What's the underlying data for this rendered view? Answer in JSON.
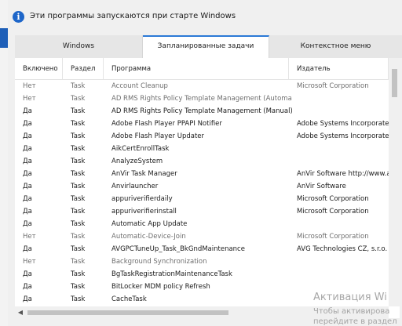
{
  "info": {
    "icon": "info-icon",
    "text": "Эти программы запускаются при старте Windows"
  },
  "tabs": [
    {
      "label": "Windows",
      "active": false
    },
    {
      "label": "Запланированные задачи",
      "active": true
    },
    {
      "label": "Контекстное меню",
      "active": false
    }
  ],
  "table": {
    "columns": [
      "Включено",
      "Раздел",
      "Программа",
      "Издатель"
    ],
    "rows": [
      {
        "enabled": "Нет",
        "section": "Task",
        "program": "Account Cleanup",
        "publisher": "Microsoft Corporation"
      },
      {
        "enabled": "Нет",
        "section": "Task",
        "program": "AD RMS Rights Policy Template Management (Automated)",
        "publisher": ""
      },
      {
        "enabled": "Да",
        "section": "Task",
        "program": "AD RMS Rights Policy Template Management (Manual)",
        "publisher": ""
      },
      {
        "enabled": "Да",
        "section": "Task",
        "program": "Adobe Flash Player PPAPI Notifier",
        "publisher": "Adobe Systems Incorporated"
      },
      {
        "enabled": "Да",
        "section": "Task",
        "program": "Adobe Flash Player Updater",
        "publisher": "Adobe Systems Incorporated"
      },
      {
        "enabled": "Да",
        "section": "Task",
        "program": "AikCertEnrollTask",
        "publisher": ""
      },
      {
        "enabled": "Да",
        "section": "Task",
        "program": "AnalyzeSystem",
        "publisher": ""
      },
      {
        "enabled": "Да",
        "section": "Task",
        "program": "AnVir Task Manager",
        "publisher": "AnVir Software http://www.an"
      },
      {
        "enabled": "Да",
        "section": "Task",
        "program": "Anvirlauncher",
        "publisher": "AnVir Software"
      },
      {
        "enabled": "Да",
        "section": "Task",
        "program": "appuriverifierdaily",
        "publisher": "Microsoft Corporation"
      },
      {
        "enabled": "Да",
        "section": "Task",
        "program": "appuriverifierinstall",
        "publisher": "Microsoft Corporation"
      },
      {
        "enabled": "Да",
        "section": "Task",
        "program": "Automatic App Update",
        "publisher": ""
      },
      {
        "enabled": "Нет",
        "section": "Task",
        "program": "Automatic-Device-Join",
        "publisher": "Microsoft Corporation"
      },
      {
        "enabled": "Да",
        "section": "Task",
        "program": "AVGPCTuneUp_Task_BkGndMaintenance",
        "publisher": "AVG Technologies CZ, s.r.o."
      },
      {
        "enabled": "Нет",
        "section": "Task",
        "program": "Background Synchronization",
        "publisher": ""
      },
      {
        "enabled": "Да",
        "section": "Task",
        "program": "BgTaskRegistrationMaintenanceTask",
        "publisher": ""
      },
      {
        "enabled": "Да",
        "section": "Task",
        "program": "BitLocker MDM policy Refresh",
        "publisher": ""
      },
      {
        "enabled": "Да",
        "section": "Task",
        "program": "CacheTask",
        "publisher": ""
      }
    ]
  },
  "scrollbar": {
    "left_arrow": "◀"
  },
  "watermark": {
    "line1": "Активация Wi",
    "line2": "Чтобы активирова",
    "line3": "перейдите в раздел"
  }
}
